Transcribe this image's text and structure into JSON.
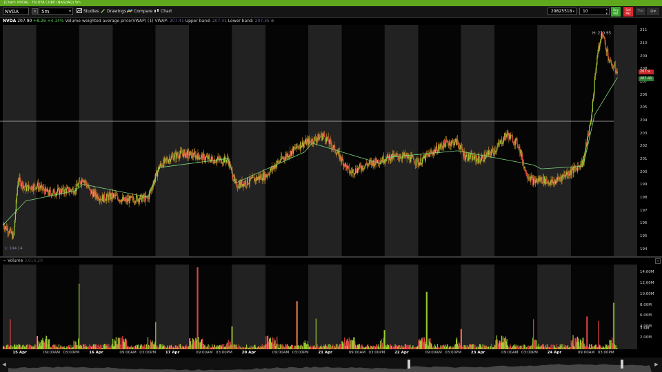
{
  "window_title": "[Chart: NVDA] - TN DTA CORE (NASDAQ) 5m",
  "toolbar": {
    "symbol": "NVDA",
    "interval": "5m",
    "buttons": [
      "Studies",
      "Drawings",
      "Compare",
      "Chart"
    ],
    "account": "29825518",
    "quantity": "10",
    "buy_label": "Buy Mkt",
    "sell_label": "Sell Mkt",
    "flat_label": "Flat"
  },
  "info": {
    "symbol": "NVDA",
    "last": "207.90",
    "change": "+8.26",
    "change_pct": "+4.14%",
    "study": "Volume-weighted average price(VWAP) (1)",
    "vwap_label": "VWAP:",
    "vwap": "207.41",
    "upper_label": "Upper band:",
    "upper": "207.41",
    "lower_label": "Lower band:",
    "lower": "207.35"
  },
  "price_axis": [
    "211",
    "210",
    "209",
    "208",
    "207",
    "206",
    "205",
    "204",
    "203",
    "202",
    "201",
    "200",
    "199",
    "198",
    "197",
    "196",
    "195",
    "194"
  ],
  "price_tags": {
    "last": "207.9",
    "vwap": "207.41"
  },
  "annotations": {
    "high": "H: 210.95",
    "low": "L: 194.14"
  },
  "volume": {
    "label": "Volume",
    "value": "3,616,20"
  },
  "volume_axis": [
    "14.00M",
    "12.00M",
    "10.00M",
    "8.00M",
    "6.00M",
    "4.00M",
    "2.00M",
    "3.6M"
  ],
  "time_axis": [
    {
      "label": "15 Apr",
      "day": true
    },
    {
      "label": "09:00AM"
    },
    {
      "label": "03:00PM"
    },
    {
      "label": "16 Apr",
      "day": true
    },
    {
      "label": "09:00AM"
    },
    {
      "label": "03:00PM"
    },
    {
      "label": "17 Apr",
      "day": true
    },
    {
      "label": "09:00AM"
    },
    {
      "label": "03:00PM"
    },
    {
      "label": "20 Apr",
      "day": true
    },
    {
      "label": "09:00AM"
    },
    {
      "label": "03:00PM"
    },
    {
      "label": "21 Apr",
      "day": true
    },
    {
      "label": "09:00AM"
    },
    {
      "label": "03:00PM"
    },
    {
      "label": "22 Apr",
      "day": true
    },
    {
      "label": "09:00AM"
    },
    {
      "label": "03:00PM"
    },
    {
      "label": "23 Apr",
      "day": true
    },
    {
      "label": "09:00AM"
    },
    {
      "label": "03:00PM"
    },
    {
      "label": "24 Apr",
      "day": true
    },
    {
      "label": "09:00AM"
    },
    {
      "label": "03:00PM"
    }
  ],
  "chart_data": {
    "type": "line",
    "y_range": [
      193.5,
      211.5
    ],
    "horizontal_line": 204.0,
    "days": [
      "15 Apr",
      "16 Apr",
      "17 Apr",
      "20 Apr",
      "21 Apr",
      "22 Apr",
      "23 Apr",
      "24 Apr"
    ],
    "price_path": [
      [
        0,
        196.0
      ],
      [
        0.08,
        195.5
      ],
      [
        0.14,
        195.0
      ],
      [
        0.2,
        199.5
      ],
      [
        0.3,
        198.8
      ],
      [
        0.45,
        199.0
      ],
      [
        0.6,
        198.4
      ],
      [
        0.8,
        198.6
      ],
      [
        0.95,
        198.7
      ],
      [
        1.05,
        199.6
      ],
      [
        1.15,
        198.5
      ],
      [
        1.3,
        198.0
      ],
      [
        1.45,
        198.2
      ],
      [
        1.6,
        197.8
      ],
      [
        1.75,
        198.0
      ],
      [
        1.9,
        198.0
      ],
      [
        2.05,
        200.5
      ],
      [
        2.2,
        201.2
      ],
      [
        2.35,
        201.5
      ],
      [
        2.55,
        201.3
      ],
      [
        2.75,
        201.0
      ],
      [
        2.95,
        201.0
      ],
      [
        3.05,
        199.0
      ],
      [
        3.25,
        199.4
      ],
      [
        3.45,
        199.8
      ],
      [
        3.6,
        200.8
      ],
      [
        3.75,
        201.5
      ],
      [
        3.9,
        202.2
      ],
      [
        4.05,
        202.5
      ],
      [
        4.2,
        202.9
      ],
      [
        4.35,
        201.8
      ],
      [
        4.55,
        200.0
      ],
      [
        4.75,
        200.6
      ],
      [
        4.95,
        201.0
      ],
      [
        5.05,
        201.2
      ],
      [
        5.25,
        201.3
      ],
      [
        5.45,
        200.8
      ],
      [
        5.6,
        201.5
      ],
      [
        5.8,
        202.3
      ],
      [
        5.95,
        202.4
      ],
      [
        6.05,
        201.3
      ],
      [
        6.25,
        201.0
      ],
      [
        6.45,
        201.8
      ],
      [
        6.6,
        203.0
      ],
      [
        6.75,
        202.2
      ],
      [
        6.85,
        200.0
      ],
      [
        6.95,
        199.3
      ],
      [
        7.05,
        199.5
      ],
      [
        7.2,
        199.2
      ],
      [
        7.35,
        199.8
      ],
      [
        7.5,
        200.3
      ],
      [
        7.6,
        200.9
      ],
      [
        7.7,
        204.0
      ],
      [
        7.78,
        209.0
      ],
      [
        7.85,
        210.9
      ],
      [
        7.95,
        208.5
      ],
      [
        8.05,
        207.9
      ]
    ],
    "vwap_path": [
      [
        0,
        195.9
      ],
      [
        0.3,
        197.8
      ],
      [
        0.95,
        198.6
      ],
      [
        1.05,
        199.1
      ],
      [
        1.9,
        198.1
      ],
      [
        2.05,
        200.4
      ],
      [
        2.95,
        201.1
      ],
      [
        3.05,
        199.2
      ],
      [
        3.95,
        201.6
      ],
      [
        4.05,
        202.3
      ],
      [
        4.95,
        200.7
      ],
      [
        5.05,
        201.2
      ],
      [
        5.95,
        201.7
      ],
      [
        6.05,
        201.6
      ],
      [
        6.95,
        200.6
      ],
      [
        7.05,
        200.3
      ],
      [
        7.6,
        200.5
      ],
      [
        7.75,
        204.5
      ],
      [
        8.05,
        207.41
      ]
    ],
    "volume_spikes_millions": [
      [
        0.1,
        5.5
      ],
      [
        0.45,
        2.4
      ],
      [
        1.0,
        12.0
      ],
      [
        1.9,
        2.2
      ],
      [
        2.0,
        5.0
      ],
      [
        2.55,
        15.0
      ],
      [
        3.0,
        4.2
      ],
      [
        3.5,
        1.8
      ],
      [
        3.85,
        8.8
      ],
      [
        4.1,
        5.6
      ],
      [
        4.6,
        2.2
      ],
      [
        5.0,
        3.5
      ],
      [
        5.55,
        10.5
      ],
      [
        6.0,
        3.7
      ],
      [
        6.6,
        1.9
      ],
      [
        6.95,
        5.5
      ],
      [
        7.5,
        2.0
      ],
      [
        7.65,
        6.0
      ],
      [
        7.8,
        5.2
      ],
      [
        8.0,
        8.5
      ]
    ]
  }
}
